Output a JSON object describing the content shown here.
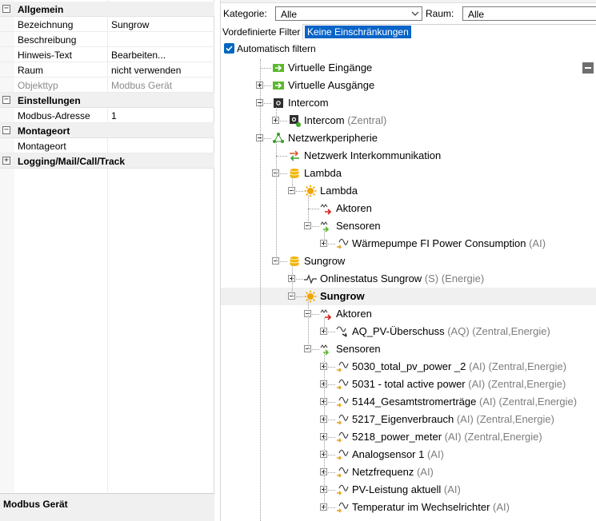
{
  "properties": {
    "categories": [
      {
        "title": "Allgemein",
        "expanded": true,
        "rows": [
          {
            "name": "Bezeichnung",
            "value": "Sungrow",
            "readonly": false
          },
          {
            "name": "Beschreibung",
            "value": "",
            "readonly": false
          },
          {
            "name": "Hinweis-Text",
            "value": "Bearbeiten...",
            "readonly": false
          },
          {
            "name": "Raum",
            "value": "nicht verwenden",
            "readonly": false
          },
          {
            "name": "Objekttyp",
            "value": "Modbus Gerät",
            "readonly": true
          }
        ]
      },
      {
        "title": "Einstellungen",
        "expanded": true,
        "rows": [
          {
            "name": "Modbus-Adresse",
            "value": "1",
            "readonly": false
          }
        ]
      },
      {
        "title": "Montageort",
        "expanded": true,
        "rows": [
          {
            "name": "Montageort",
            "value": "",
            "readonly": false
          }
        ]
      },
      {
        "title": "Logging/Mail/Call/Track",
        "expanded": false,
        "rows": []
      }
    ],
    "description_title": "Modbus Gerät"
  },
  "filters": {
    "kategorie_label": "Kategorie:",
    "kategorie_value": "Alle",
    "raum_label": "Raum:",
    "raum_value": "Alle",
    "predefined_label": "Vordefinierte Filter",
    "predefined_value": "Keine Einschränkungen",
    "auto_filter_label": "Automatisch filtern",
    "auto_filter_checked": true
  },
  "tree": [
    {
      "label": "Virtuelle Eingänge",
      "suffix": "",
      "level": 1,
      "toggle": "none",
      "icon": "virtual-input-icon",
      "bold": false
    },
    {
      "label": "Virtuelle Ausgänge",
      "suffix": "",
      "level": 1,
      "toggle": "plus",
      "icon": "virtual-output-icon",
      "bold": false
    },
    {
      "label": "Intercom",
      "suffix": "",
      "level": 1,
      "toggle": "minus",
      "icon": "intercom-icon",
      "bold": false
    },
    {
      "label": "Intercom",
      "suffix": " (Zentral)",
      "level": 2,
      "toggle": "plus",
      "icon": "intercom-device-icon",
      "bold": false
    },
    {
      "label": "Netzwerkperipherie",
      "suffix": "",
      "level": 1,
      "toggle": "minus",
      "icon": "network-peripheral-icon",
      "bold": false
    },
    {
      "label": "Netzwerk Interkommunikation",
      "suffix": "",
      "level": 2,
      "toggle": "none",
      "icon": "network-intercomm-icon",
      "bold": false
    },
    {
      "label": "Lambda",
      "suffix": "",
      "level": 2,
      "toggle": "minus",
      "icon": "database-icon",
      "bold": false
    },
    {
      "label": "Lambda",
      "suffix": "",
      "level": 3,
      "toggle": "minus",
      "icon": "device-sun-icon",
      "bold": false
    },
    {
      "label": "Aktoren",
      "suffix": "",
      "level": 4,
      "toggle": "none",
      "icon": "actuator-icon",
      "bold": false
    },
    {
      "label": "Sensoren",
      "suffix": "",
      "level": 4,
      "toggle": "minus",
      "icon": "sensor-icon",
      "bold": false
    },
    {
      "label": "Wärmepumpe FI Power Consumption",
      "suffix": " (AI)",
      "level": 5,
      "toggle": "plus",
      "icon": "analog-input-icon",
      "bold": false
    },
    {
      "label": "Sungrow",
      "suffix": "",
      "level": 2,
      "toggle": "minus",
      "icon": "database-icon",
      "bold": false
    },
    {
      "label": "Onlinestatus Sungrow",
      "suffix": " (S) (Energie)",
      "level": 3,
      "toggle": "plus",
      "icon": "status-wave-icon",
      "bold": false
    },
    {
      "label": "Sungrow",
      "suffix": "",
      "level": 3,
      "toggle": "minus",
      "icon": "device-sun-icon",
      "bold": true,
      "selected": true
    },
    {
      "label": "Aktoren",
      "suffix": "",
      "level": 4,
      "toggle": "minus",
      "icon": "actuator-icon",
      "bold": false
    },
    {
      "label": "AQ_PV-Überschuss",
      "suffix": " (AQ) (Zentral,Energie)",
      "level": 5,
      "toggle": "plus",
      "icon": "analog-output-icon",
      "bold": false
    },
    {
      "label": "Sensoren",
      "suffix": "",
      "level": 4,
      "toggle": "minus",
      "icon": "sensor-icon",
      "bold": false
    },
    {
      "label": "5030_total_pv_power _2",
      "suffix": " (AI) (Zentral,Energie)",
      "level": 5,
      "toggle": "plus",
      "icon": "analog-input-icon",
      "bold": false
    },
    {
      "label": "5031 - total active power",
      "suffix": " (AI) (Zentral,Energie)",
      "level": 5,
      "toggle": "plus",
      "icon": "analog-input-icon",
      "bold": false
    },
    {
      "label": "5144_Gesamtstromerträge",
      "suffix": " (AI) (Zentral,Energie)",
      "level": 5,
      "toggle": "plus",
      "icon": "analog-input-icon",
      "bold": false
    },
    {
      "label": "5217_Eigenverbrauch",
      "suffix": " (AI) (Zentral,Energie)",
      "level": 5,
      "toggle": "plus",
      "icon": "analog-input-icon",
      "bold": false
    },
    {
      "label": "5218_power_meter",
      "suffix": " (AI) (Zentral,Energie)",
      "level": 5,
      "toggle": "plus",
      "icon": "analog-input-icon",
      "bold": false
    },
    {
      "label": "Analogsensor 1",
      "suffix": " (AI)",
      "level": 5,
      "toggle": "plus",
      "icon": "analog-input-icon",
      "bold": false
    },
    {
      "label": "Netzfrequenz",
      "suffix": " (AI)",
      "level": 5,
      "toggle": "plus",
      "icon": "analog-input-icon",
      "bold": false
    },
    {
      "label": "PV-Leistung aktuell",
      "suffix": " (AI)",
      "level": 5,
      "toggle": "plus",
      "icon": "analog-input-icon",
      "bold": false
    },
    {
      "label": "Temperatur im Wechselrichter",
      "suffix": " (AI)",
      "level": 5,
      "toggle": "plus",
      "icon": "analog-input-icon",
      "bold": false
    }
  ],
  "colors": {
    "selection": "#0a64c8",
    "checkbox": "#0067c0",
    "highlight_row": "#f0f0f0",
    "dim_text": "#7d7d7d",
    "virtual_green": "#5cb82c",
    "sensor_orange": "#e8a317",
    "actuator_red": "#d21f1f"
  }
}
